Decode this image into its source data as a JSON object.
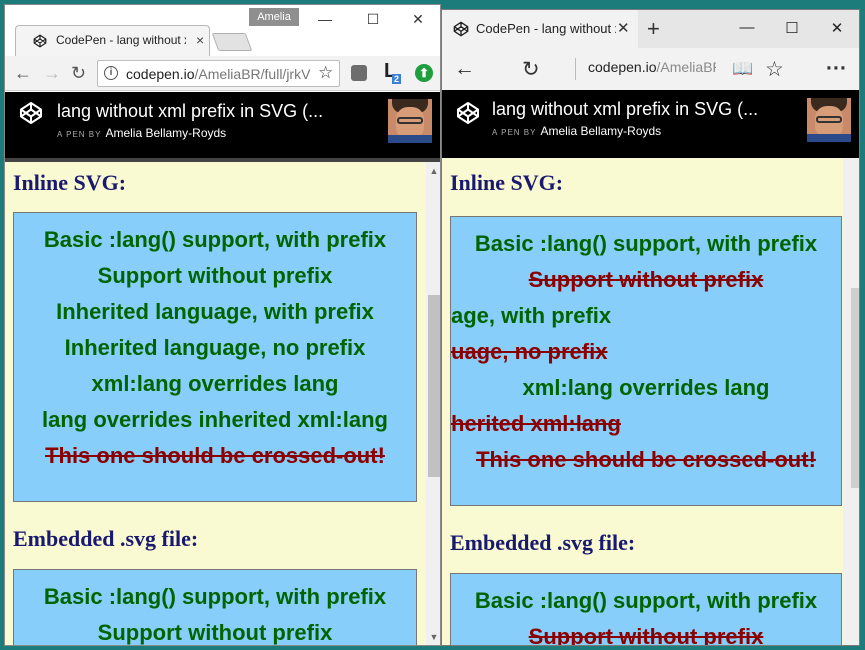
{
  "left_browser": {
    "profile_name": "Amelia",
    "tab_title": "CodePen - lang without xml prefix",
    "tab_close": "×",
    "window_controls": {
      "minimize": "—",
      "maximize": "☐",
      "close": "✕"
    },
    "nav": {
      "back": "←",
      "forward": "→",
      "reload": "↻"
    },
    "url_host": "codepen.io",
    "url_path": "/AmeliaBR/full/jrkV",
    "info_glyph": "i",
    "star": "☆",
    "ext_letter": "L",
    "ext_badge": "2",
    "ext_update_glyph": "⬆"
  },
  "right_browser": {
    "tab_title": "CodePen - lang without xml prefix",
    "tab_close": "✕",
    "new_tab": "+",
    "window_controls": {
      "minimize": "—",
      "maximize": "☐",
      "close": "✕"
    },
    "nav": {
      "back": "←",
      "reload": "↻"
    },
    "url_host": "codepen.io",
    "url_path": "/AmeliaBR/f",
    "reading_icon": "📖",
    "star": "☆",
    "more": "···"
  },
  "pen": {
    "title": "lang without xml prefix in SVG (...",
    "by_label": "A PEN BY",
    "author": "Amelia Bellamy-Royds"
  },
  "content": {
    "inline_heading": "Inline SVG:",
    "embedded_heading": "Embedded .svg file:",
    "left_inline_lines": [
      {
        "text": "Basic :lang() support, with prefix",
        "status": "ok"
      },
      {
        "text": "Support without prefix",
        "status": "ok"
      },
      {
        "text": "Inherited language, with prefix",
        "status": "ok"
      },
      {
        "text": "Inherited language, no prefix",
        "status": "ok"
      },
      {
        "text": "xml:lang overrides lang",
        "status": "ok"
      },
      {
        "text": "lang overrides inherited xml:lang",
        "status": "ok"
      },
      {
        "text": "This one should be crossed-out!",
        "status": "bad"
      }
    ],
    "right_inline_lines": [
      {
        "text": "Basic :lang() support, with prefix",
        "status": "ok"
      },
      {
        "text": "Support without prefix",
        "status": "bad"
      },
      {
        "text": "age, with prefix",
        "status": "ok"
      },
      {
        "text": "uage, no prefix",
        "status": "bad"
      },
      {
        "text": "xml:lang overrides lang",
        "status": "ok"
      },
      {
        "text": "herited xml:lang",
        "status": "bad"
      },
      {
        "text": "This one should be crossed-out!",
        "status": "bad"
      }
    ],
    "left_embedded_lines": [
      {
        "text": "Basic :lang() support, with prefix",
        "status": "ok"
      },
      {
        "text": "Support without prefix",
        "status": "ok"
      }
    ],
    "right_embedded_lines": [
      {
        "text": "Basic :lang() support, with prefix",
        "status": "ok"
      },
      {
        "text": "Support without prefix",
        "status": "bad"
      }
    ]
  },
  "colors": {
    "page_background": "#fafad2",
    "svg_background": "#87cefa",
    "heading": "#191970",
    "pass_text": "#006400",
    "fail_text": "#8b0000",
    "desktop": "#1c7c7c"
  }
}
